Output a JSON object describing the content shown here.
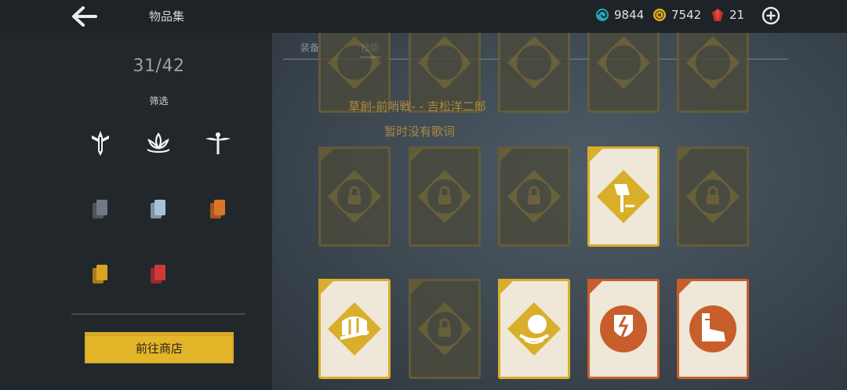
{
  "header": {
    "title": "物品集",
    "currencies": [
      {
        "name": "swirl-currency",
        "value": "9844",
        "color": "#2aa7b5"
      },
      {
        "name": "gold-coin",
        "value": "7542",
        "color": "#e0b32a"
      },
      {
        "name": "red-gem",
        "value": "21",
        "color": "#c8302a"
      }
    ]
  },
  "sidebar": {
    "count": "31/42",
    "filter_label": "筛选",
    "class_icons": [
      "sword-class-icon",
      "lotus-class-icon",
      "dragonfly-class-icon"
    ],
    "rarity_colors": [
      "#6f7a85",
      "#a9c1d8",
      "#d9762a",
      "#d9a323",
      "#cc3a3a"
    ],
    "shop_button": "前往商店"
  },
  "tabs": {
    "equipment": "装备",
    "skills": "技能"
  },
  "overlay": {
    "song_line": "草創-前哨戦- - 吉松洋二郎",
    "no_lyrics": "暂时没有歌词"
  },
  "colors": {
    "accent_gold": "#d9ae2b",
    "accent_orange": "#c75e2b"
  }
}
